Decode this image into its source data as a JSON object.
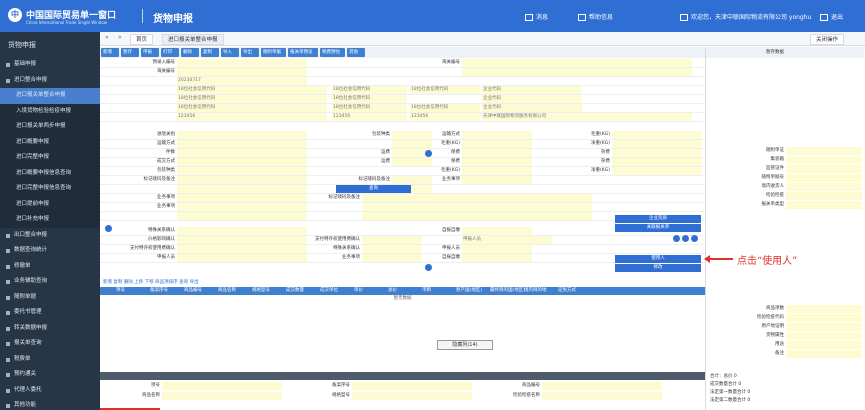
{
  "header": {
    "logo_mark": "中",
    "logo_cn": "中国国际贸易单一窗口",
    "logo_en": "China International Trade Single Window",
    "app_title": "货物申报",
    "messages_label": "消息",
    "help_label": "帮助信息",
    "user_label": "欢迎您，天津中联国际物流有限公司 yonghu",
    "logout_label": "退出"
  },
  "sidebar": {
    "title": "货物申报",
    "items": [
      {
        "label": "基础申报",
        "sub": false,
        "active": false
      },
      {
        "label": "进口整合申报",
        "sub": false,
        "active": false
      },
      {
        "label": "进口报关单整合申报",
        "sub": true,
        "active": true
      },
      {
        "label": "入境货物检验检疫申报",
        "sub": true,
        "active": false
      },
      {
        "label": "进口报关单两步申报",
        "sub": true,
        "active": false
      },
      {
        "label": "进口概要申报",
        "sub": true,
        "active": false
      },
      {
        "label": "进口完整申报",
        "sub": true,
        "active": false
      },
      {
        "label": "进口概要申报信息查询",
        "sub": true,
        "active": false
      },
      {
        "label": "进口完整申报信息查询",
        "sub": true,
        "active": false
      },
      {
        "label": "进口提前申报",
        "sub": true,
        "active": false
      },
      {
        "label": "进口补充申报",
        "sub": true,
        "active": false
      },
      {
        "label": "出口整合申报",
        "sub": false,
        "active": false
      },
      {
        "label": "数据查询统计",
        "sub": false,
        "active": false
      },
      {
        "label": "修撤单",
        "sub": false,
        "active": false
      },
      {
        "label": "业务辅助查询",
        "sub": false,
        "active": false
      },
      {
        "label": "随附单据",
        "sub": false,
        "active": false
      },
      {
        "label": "委托书管理",
        "sub": false,
        "active": false
      },
      {
        "label": "转关数据申报",
        "sub": false,
        "active": false
      },
      {
        "label": "报关单查询",
        "sub": false,
        "active": false
      },
      {
        "label": "税费单",
        "sub": false,
        "active": false
      },
      {
        "label": "预约通关",
        "sub": false,
        "active": false
      },
      {
        "label": "代理人委托",
        "sub": false,
        "active": false
      },
      {
        "label": "其他功能",
        "sub": false,
        "active": false
      }
    ]
  },
  "tabs": {
    "home": "首页",
    "current": "进口报关单整合申报",
    "close_others": "关闭操作"
  },
  "toolbar": {
    "buttons": [
      "新增",
      "暂存",
      "申报",
      "打印",
      "删除",
      "复制",
      "导入",
      "导出",
      "随附单据",
      "报关单预览",
      "税费预估",
      "其他"
    ]
  },
  "form": {
    "fields": {
      "pre_entry_no": "预录入编号",
      "customs_no": "海关编号",
      "declare_date": "20230717",
      "consignee_placeholder": "18位社会信用代码",
      "org_code": "企业代码",
      "user_code_tel": "123456",
      "firm_name": "天津中联国际物流服务有限公司",
      "entry_port": "进境关别",
      "package_type": "包装种类",
      "transport_mode": "运输方式",
      "gross_weight": "毛重(KG)",
      "net_weight": "净重(KG)",
      "pack_count": "件数",
      "freight": "运费",
      "insurance": "保费",
      "misc_fee": "杂费",
      "trade_terms": "成交方式",
      "remark": "标记唛码及备注",
      "spec_relation": "特殊关系确认",
      "price_influence": "价格影响确认",
      "royalty": "支付特许权使用费确认",
      "self_report": "自报自缴",
      "business_unit": "业务事项",
      "declare_person": "申报人员",
      "user_button": "使用人",
      "query_button": "查询",
      "edit_button": "修改",
      "enterprise_button": "企业资质",
      "related_button": "关联报关单"
    }
  },
  "annotation": {
    "text": "点击“使用人”"
  },
  "grid": {
    "toolbar": "新增  复制  删除  上移  下移  商品项排序  查询  导出",
    "columns": [
      "项号",
      "备案序号",
      "商品编号",
      "商品名称",
      "规格型号",
      "成交数量",
      "成交单位",
      "单价",
      "总价",
      "币制",
      "原产国(地区)",
      "最终目的国(地区)",
      "境内目的地",
      "征免方式"
    ],
    "empty_text": "暂无数据",
    "hide_label": "隐藏列(14)"
  },
  "right_panel": {
    "top_label": "暂存数据",
    "rows": [
      "随附单证",
      "集装箱",
      "监管证件",
      "随附单据号",
      "境内收货人",
      "检验检疫",
      "报关单类型"
    ],
    "bottom": [
      "商品项数",
      "检验检疫代码",
      "原产地证明",
      "货物属性",
      "用途",
      "备注"
    ],
    "footer": [
      "合计：总价 0",
      "成交数量合计 0",
      "法定第一数量合计 0",
      "法定第二数量合计 0"
    ]
  },
  "bottom_form": {
    "fields": [
      "项号",
      "备案序号",
      "商品编号",
      "商品名称",
      "规格型号",
      "检验检疫名称"
    ]
  }
}
